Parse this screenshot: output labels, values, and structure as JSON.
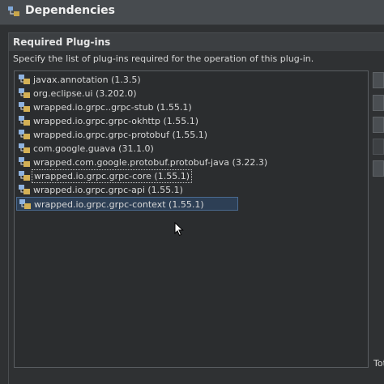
{
  "header": {
    "title": "Dependencies",
    "icon": "dependencies-icon"
  },
  "section": {
    "title": "Required Plug-ins",
    "description": "Specify the list of plug-ins required for the operation of this plug-in."
  },
  "plugins": [
    {
      "label": "javax.annotation (1.3.5)"
    },
    {
      "label": "org.eclipse.ui (3.202.0)"
    },
    {
      "label": "wrapped.io.grpc..grpc-stub (1.55.1)"
    },
    {
      "label": "wrapped.io.grpc.grpc-okhttp (1.55.1)"
    },
    {
      "label": "wrapped.io.grpc.grpc-protobuf (1.55.1)"
    },
    {
      "label": "com.google.guava (31.1.0)"
    },
    {
      "label": "wrapped.com.google.protobuf.protobuf-java (3.22.3)"
    },
    {
      "label": "wrapped.io.grpc.grpc-core (1.55.1)"
    },
    {
      "label": "wrapped.io.grpc.grpc-api (1.55.1)"
    },
    {
      "label": "wrapped.io.grpc.grpc-context (1.55.1)"
    }
  ],
  "footer": {
    "total_label": "Tot"
  },
  "colors": {
    "background": "#2f3133",
    "selection": "#2d3f55",
    "header_bar": "#474b4f"
  }
}
